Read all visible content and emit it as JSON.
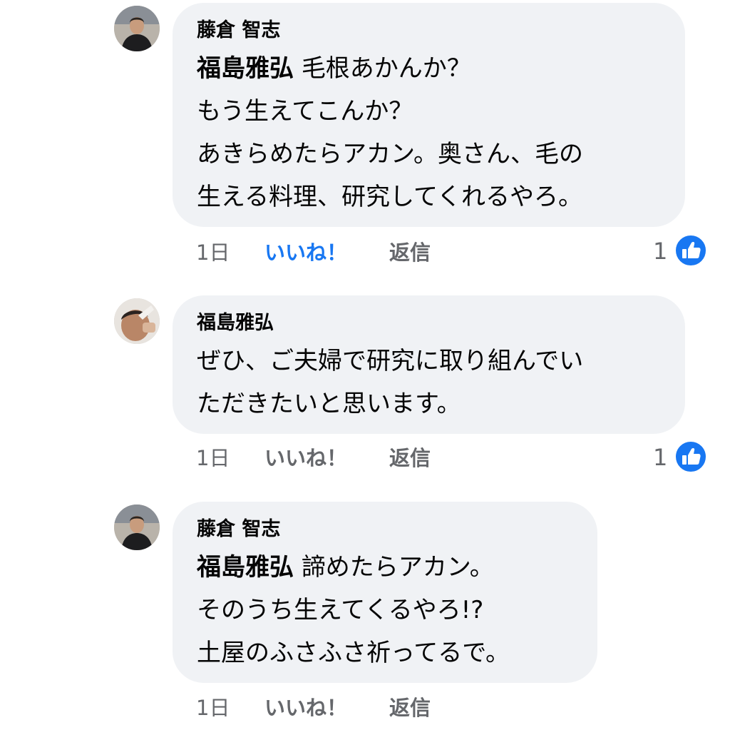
{
  "comments": [
    {
      "author": "藤倉 智志",
      "mention": "福島雅弘",
      "lines": [
        "毛根あかんか？",
        "もう生えてこんか？",
        "あきらめたらアカン。奥さん、毛の",
        "生える料理、研究してくれるやろ。"
      ],
      "time": "1日",
      "like_label": "いいね！",
      "liked": true,
      "reply_label": "返信",
      "reaction_count": "1",
      "reaction_icon": "like-icon"
    },
    {
      "author": "福島雅弘",
      "mention": "",
      "lines": [
        "ぜひ、ご夫婦で研究に取り組んでい",
        "ただきたいと思います。"
      ],
      "time": "1日",
      "like_label": "いいね！",
      "liked": false,
      "reply_label": "返信",
      "reaction_count": "1",
      "reaction_icon": "like-icon"
    },
    {
      "author": "藤倉 智志",
      "mention": "福島雅弘",
      "lines": [
        "諦めたらアカン。",
        "そのうち生えてくるやろ!?",
        "土屋のふさふさ祈ってるで。"
      ],
      "time": "1日",
      "like_label": "いいね！",
      "liked": false,
      "reply_label": "返信"
    }
  ],
  "colors": {
    "bubble": "#f0f2f5",
    "like_active": "#1877f2",
    "meta_text": "#65676b",
    "text": "#050505"
  }
}
